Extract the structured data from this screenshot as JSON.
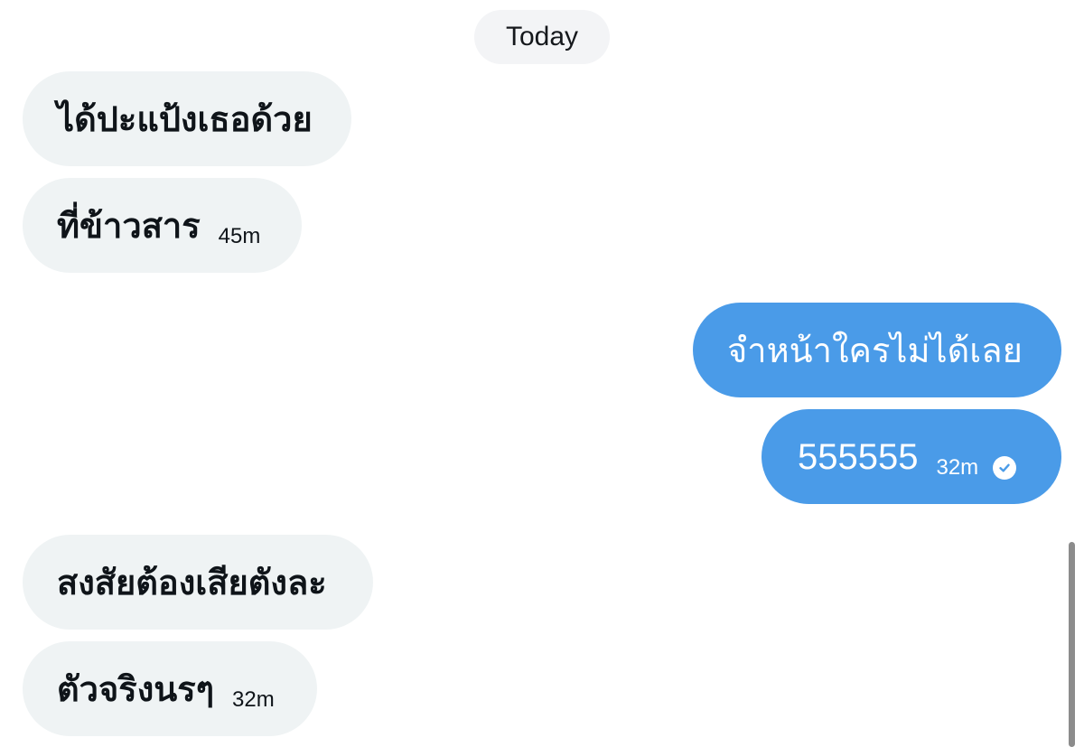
{
  "date_divider": "Today",
  "messages": [
    {
      "direction": "incoming",
      "text": "ได้ปะแป้งเธอด้วย",
      "time": ""
    },
    {
      "direction": "incoming",
      "text": "ที่ข้าวสาร",
      "time": "45m"
    },
    {
      "direction": "outgoing",
      "text": "จำหน้าใครไม่ได้เลย",
      "time": ""
    },
    {
      "direction": "outgoing",
      "text": "555555",
      "time": "32m",
      "status": "seen-check-icon"
    },
    {
      "direction": "incoming",
      "text": "สงสัยต้องเสียตังละ",
      "time": ""
    },
    {
      "direction": "incoming",
      "text": "ตัวจริงนรๆ",
      "time": "32m"
    }
  ],
  "colors": {
    "incoming_bubble": "#eff3f4",
    "outgoing_bubble": "#4a9be8",
    "date_chip": "#f3f4f6"
  }
}
